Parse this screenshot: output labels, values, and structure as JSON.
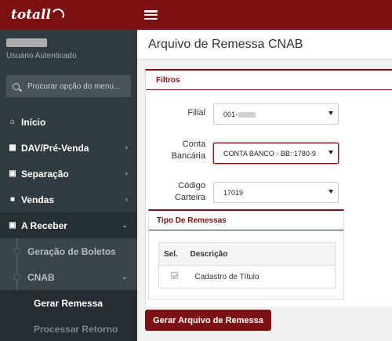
{
  "app": {
    "logo_text": "totall"
  },
  "user": {
    "status": "Usuário Autenticado"
  },
  "sidebar": {
    "search_placeholder": "Procurar opção do menu...",
    "items": [
      {
        "label": "Início",
        "icon": "home-icon"
      },
      {
        "label": "DAV/Pré-Venda",
        "icon": "basket-icon"
      },
      {
        "label": "Separação",
        "icon": "truck-icon"
      },
      {
        "label": "Vendas",
        "icon": "bag-icon"
      },
      {
        "label": "A Receber",
        "icon": "lock-bag-icon"
      }
    ],
    "subitems": [
      {
        "label": "Geração de Boletos"
      },
      {
        "label": "CNAB"
      }
    ],
    "subsubitems": [
      {
        "label": "Gerar Remessa"
      },
      {
        "label": "Processar Retorno"
      }
    ]
  },
  "page": {
    "title": "Arquivo de Remessa CNAB"
  },
  "filters": {
    "title": "Filtros",
    "filial": {
      "label": "Filial",
      "value": "001-"
    },
    "conta": {
      "label_line1": "Conta",
      "label_line2": "Bancária",
      "value": "CONTA BANCO - BB: 1780-9"
    },
    "carteira": {
      "label_line1": "Código",
      "label_line2": "Carteira",
      "value": "17019"
    }
  },
  "remessas": {
    "title": "Tipo De Remessas",
    "columns": [
      "Sel.",
      "Descrição"
    ],
    "rows": [
      {
        "description": "Cadastro de Título",
        "checked": true
      }
    ]
  },
  "actions": {
    "generate_label": "Gerar Arquivo de Remessa"
  },
  "colors": {
    "brand": "#7b1113",
    "sidebar": "#303a3f"
  }
}
